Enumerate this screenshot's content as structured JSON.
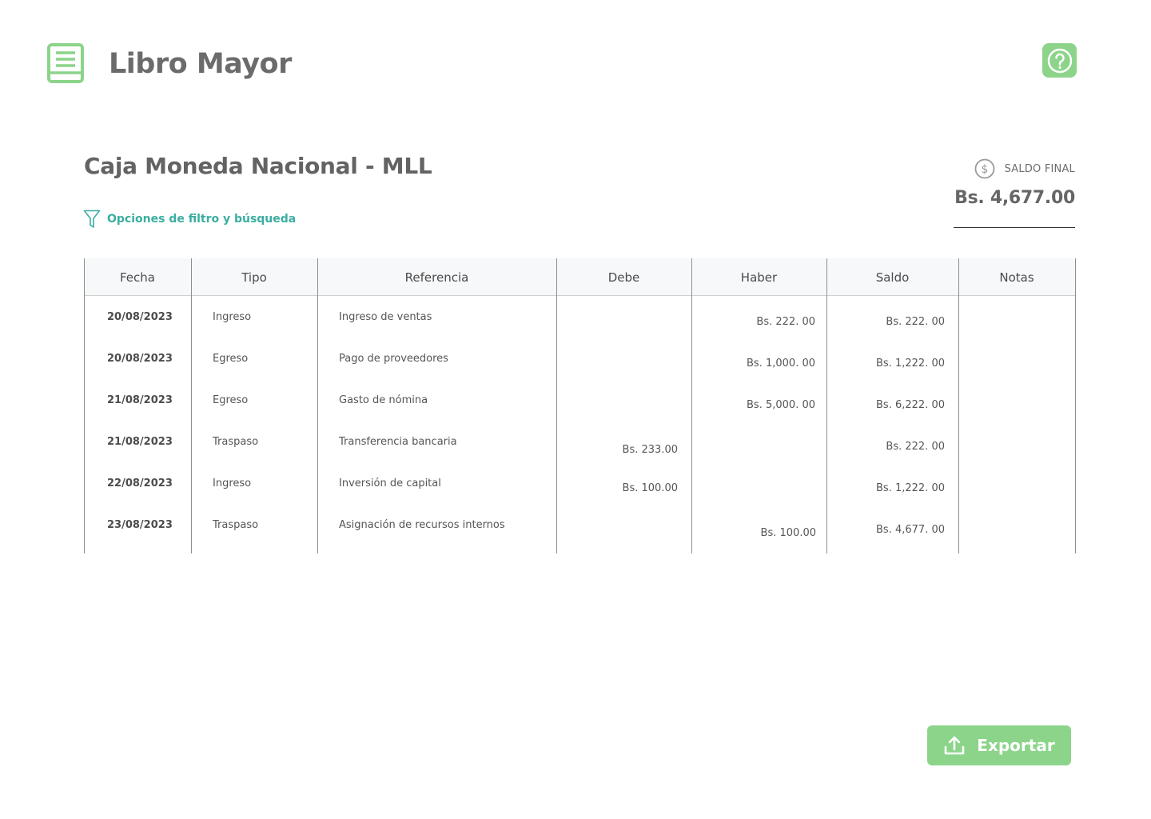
{
  "header": {
    "title": "Libro Mayor",
    "app_icon": "ledger-book-icon",
    "help_icon": "question-circle-icon"
  },
  "account": {
    "title": "Caja Moneda Nacional - MLL",
    "filter_label": "Opciones de filtro y búsqueda"
  },
  "balance": {
    "label": "SALDO FINAL",
    "value": "Bs. 4,677.00",
    "icon": "dollar-circle-icon"
  },
  "table": {
    "columns": [
      "Fecha",
      "Tipo",
      "Referencia",
      "Debe",
      "Haber",
      "Saldo",
      "Notas"
    ],
    "rows": [
      {
        "fecha": "20/08/2023",
        "tipo": "Ingreso",
        "referencia": "Ingreso de ventas",
        "debe": "",
        "haber": "Bs. 222. 00",
        "saldo": "Bs. 222. 00",
        "notas": ""
      },
      {
        "fecha": "20/08/2023",
        "tipo": "Egreso",
        "referencia": "Pago de proveedores",
        "debe": "",
        "haber": "Bs. 1,000. 00",
        "saldo": "Bs. 1,222. 00",
        "notas": ""
      },
      {
        "fecha": "21/08/2023",
        "tipo": "Egreso",
        "referencia": "Gasto de nómina",
        "debe": "",
        "haber": "Bs. 5,000. 00",
        "saldo": "Bs. 6,222. 00",
        "notas": ""
      },
      {
        "fecha": "21/08/2023",
        "tipo": "Traspaso",
        "referencia": "Transferencia bancaria",
        "debe": "Bs. 233.00",
        "haber": "",
        "saldo": "Bs. 222. 00",
        "notas": ""
      },
      {
        "fecha": "22/08/2023",
        "tipo": "Ingreso",
        "referencia": "Inversión de capital",
        "debe": "Bs. 100.00",
        "haber": "",
        "saldo": "Bs. 1,222. 00",
        "notas": ""
      },
      {
        "fecha": "23/08/2023",
        "tipo": "Traspaso",
        "referencia": "Asignación de recursos internos",
        "debe": "",
        "haber": "Bs. 100.00",
        "saldo": "Bs. 4,677. 00",
        "notas": ""
      }
    ]
  },
  "actions": {
    "export_label": "Exportar",
    "export_icon": "upload-icon"
  },
  "colors": {
    "accent_green": "#8cd48a",
    "link_teal": "#3aaea0"
  }
}
